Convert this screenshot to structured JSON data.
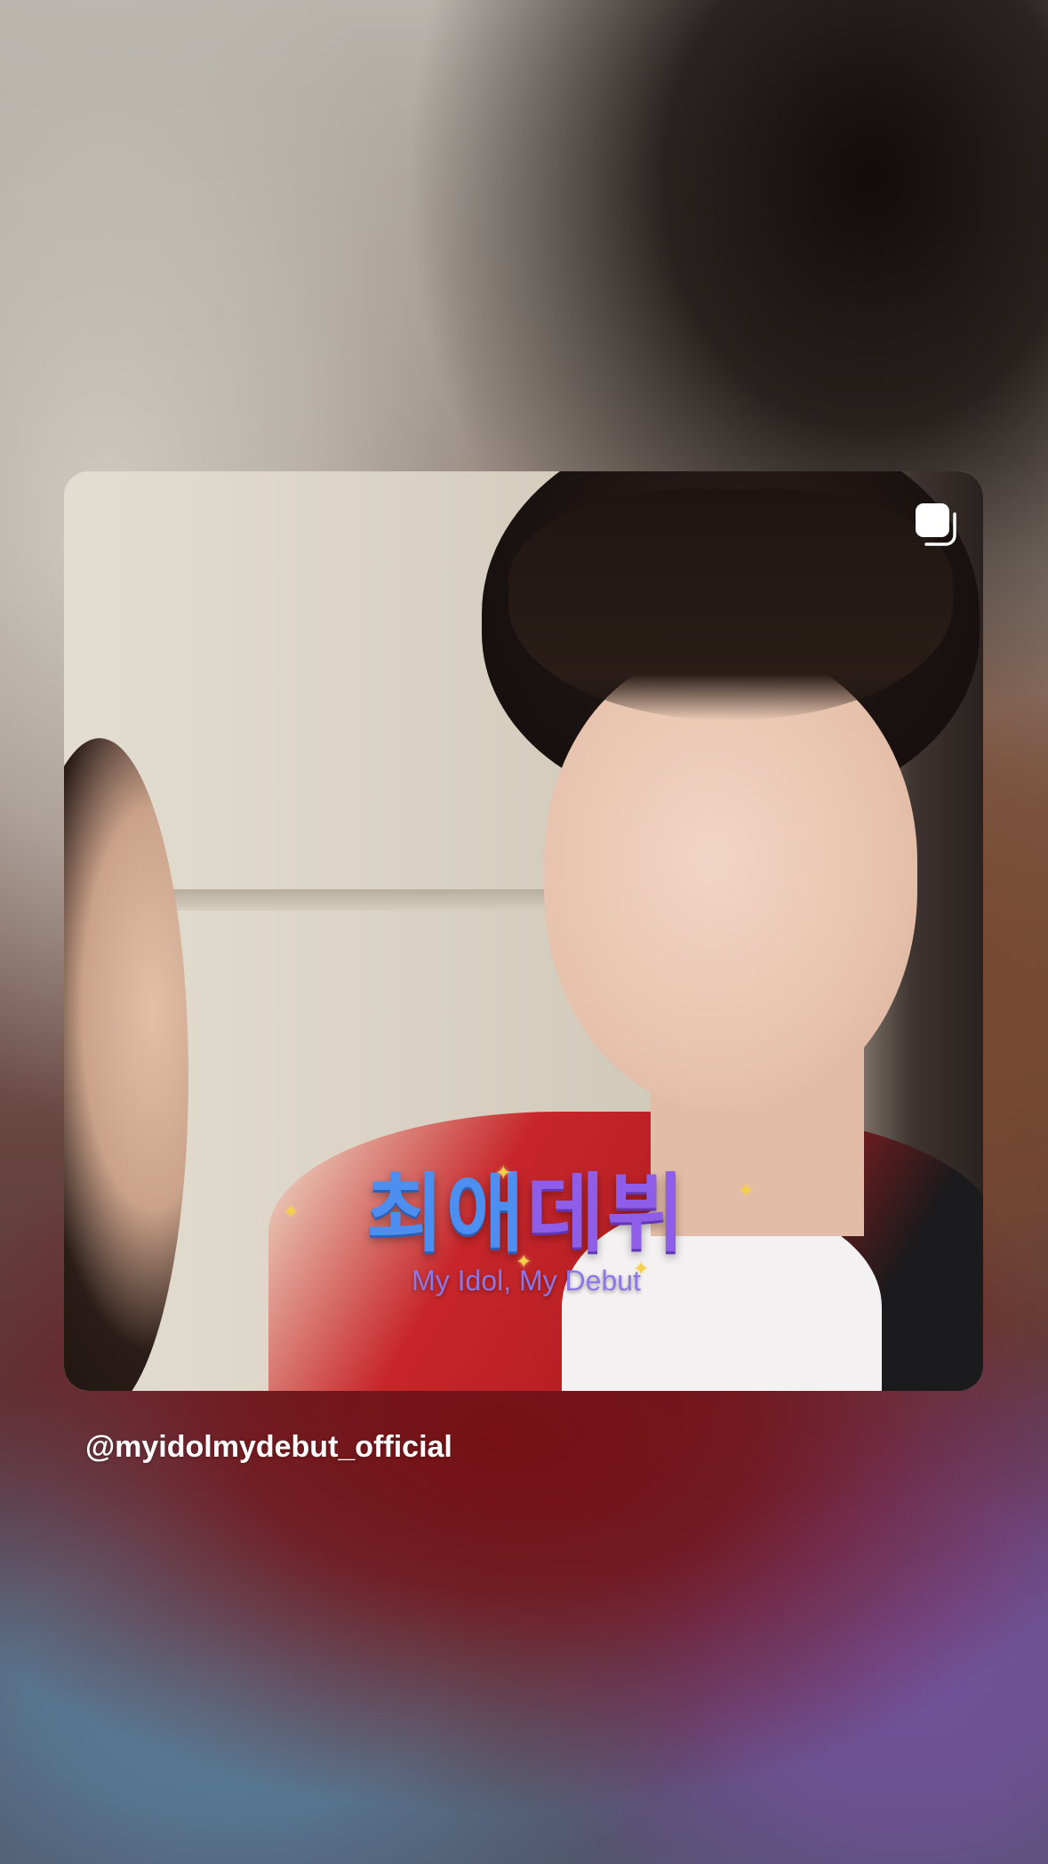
{
  "post": {
    "username": "@myidolmydebut_official",
    "multi_image_icon": "carousel-icon"
  },
  "logo": {
    "title_part1": "최애",
    "title_part2": "데뷔",
    "subtitle": "My Idol, My Debut"
  },
  "colors": {
    "logo_blue": "#4d8ff0",
    "logo_purple": "#8f5ee8",
    "username_text": "#ffffff"
  }
}
